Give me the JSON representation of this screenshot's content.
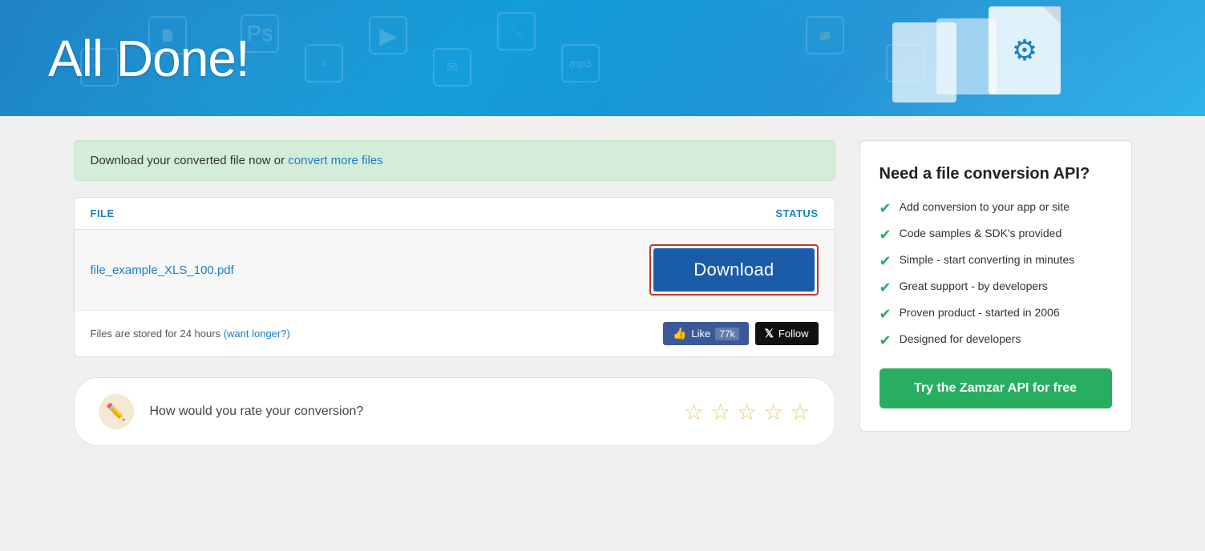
{
  "header": {
    "title": "All Done!",
    "background_color": "#1a7fc4"
  },
  "success_banner": {
    "text": "Download your converted file now or ",
    "link_text": "convert more files",
    "link_href": "#"
  },
  "file_table": {
    "col_file_label": "FILE",
    "col_status_label": "STATUS",
    "file_name": "file_example_XLS_100.pdf",
    "download_button_label": "Download",
    "footer_text": "Files are stored for 24 hours ",
    "footer_link_text": "(want longer?)",
    "facebook_label": "Like",
    "facebook_count": "77k",
    "follow_label": "Follow"
  },
  "rating": {
    "prompt": "How would you rate your conversion?",
    "stars": [
      "☆",
      "☆",
      "☆",
      "☆",
      "☆"
    ]
  },
  "api_card": {
    "title": "Need a file conversion API?",
    "features": [
      "Add conversion to your app or site",
      "Code samples & SDK's provided",
      "Simple - start converting in minutes",
      "Great support - by developers",
      "Proven product - started in 2006",
      "Designed for developers"
    ],
    "cta_label": "Try the Zamzar API for free",
    "cta_color": "#27ae60"
  },
  "icons": {
    "pencil": "✏️",
    "check": "✔",
    "x_logo": "✕",
    "facebook_thumb": "👍"
  }
}
